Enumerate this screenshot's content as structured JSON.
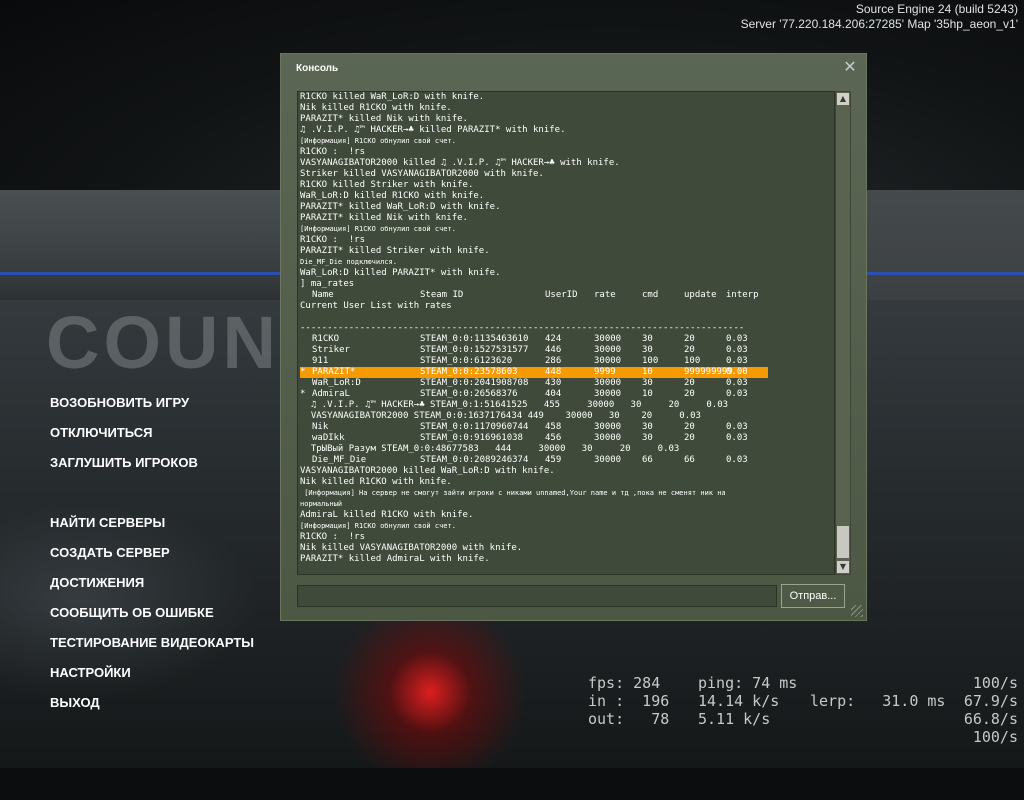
{
  "engine": {
    "version": "Source Engine 24 (build 5243)",
    "server": "Server '77.220.184.206:27285' Map '35hp_aeon_v1'"
  },
  "background_logo": "COUNTER-STRIKE",
  "menu": [
    "ВОЗОБНОВИТЬ ИГРУ",
    "ОТКЛЮЧИТЬСЯ",
    "ЗАГЛУШИТЬ ИГРОКОВ",
    "НАЙТИ СЕРВЕРЫ",
    "СОЗДАТЬ СЕРВЕР",
    "ДОСТИЖЕНИЯ",
    "СООБЩИТЬ ОБ ОШИБКЕ",
    "ТЕСТИРОВАНИЕ ВИДЕОКАРТЫ",
    "НАСТРОЙКИ",
    "ВЫХОД"
  ],
  "console": {
    "title": "Консоль",
    "close_glyph": "✕",
    "send_label": "Отправ...",
    "input_value": "",
    "log_before": [
      {
        "t": "R1CKO killed WaR_LoR:D with knife."
      },
      {
        "t": "Nik killed R1CKO with knife."
      },
      {
        "t": "PARAZIT* killed Nik with knife."
      },
      {
        "t": "♫ .V.I.P. ♫™ HACKER→♣ killed PARAZIT* with knife."
      },
      {
        "t": "[Информация] R1CKO обнулил свой счет.",
        "small": true
      },
      {
        "t": "R1CKO :  !rs"
      },
      {
        "t": "VASYANAGIBATOR2000 killed ♫ .V.I.P. ♫™ HACKER→♣ with knife."
      },
      {
        "t": "Striker killed VASYANAGIBATOR2000 with knife."
      },
      {
        "t": "R1CKO killed Striker with knife."
      },
      {
        "t": "WaR_LoR:D killed R1CKO with knife."
      },
      {
        "t": "PARAZIT* killed WaR_LoR:D with knife."
      },
      {
        "t": "PARAZIT* killed Nik with knife."
      },
      {
        "t": "[Информация] R1CKO обнулил свой счет.",
        "small": true
      },
      {
        "t": "R1CKO :  !rs"
      },
      {
        "t": "PARAZIT* killed Striker with knife."
      },
      {
        "t": "Die_MF_Die подключился.",
        "small": true
      },
      {
        "t": "WaR_LoR:D killed PARAZIT* with knife."
      },
      {
        "t": "] ma_rates"
      }
    ],
    "rates_header": {
      "name": "Name",
      "steam": "Steam ID",
      "uid": "UserID",
      "rate": "rate",
      "cmd": "cmd",
      "update": "update",
      "interp": "interp"
    },
    "rates_title": "Current User List with rates",
    "rates_separator": "----------------------------------------------------------------------------------",
    "rates_rows": [
      {
        "mark": "",
        "name": "R1CKO",
        "steam": "STEAM_0:0:1135463610",
        "uid": "424",
        "rate": "30000",
        "cmd": "30",
        "update": "20",
        "interp": "0.03"
      },
      {
        "mark": "",
        "name": "Striker",
        "steam": "STEAM_0:0:1527531577",
        "uid": "446",
        "rate": "30000",
        "cmd": "30",
        "update": "20",
        "interp": "0.03"
      },
      {
        "mark": "",
        "name": "911",
        "steam": "STEAM_0:0:6123620",
        "uid": "286",
        "rate": "30000",
        "cmd": "100",
        "update": "100",
        "interp": "0.03"
      },
      {
        "mark": "*",
        "name": "PARAZIT*",
        "steam": "STEAM_0:0:23578603",
        "uid": "448",
        "rate": "9999",
        "cmd": "10",
        "update": "999999999",
        "interp": "0.00",
        "highlight": true
      },
      {
        "mark": "",
        "name": "WaR_LoR:D",
        "steam": "STEAM_0:0:2041908708",
        "uid": "430",
        "rate": "30000",
        "cmd": "30",
        "update": "20",
        "interp": "0.03"
      },
      {
        "mark": "*",
        "name": "AdmiraL",
        "steam": "STEAM_0:0:26568376",
        "uid": "404",
        "rate": "30000",
        "cmd": "10",
        "update": "20",
        "interp": "0.03"
      }
    ],
    "rates_raw": [
      "  ♫ .V.I.P. ♫™ HACKER→♣ STEAM_0:1:51641525   455     30000   30     20     0.03",
      "  VASYANAGIBATOR2000 STEAM_0:0:1637176434 449    30000   30    20     0.03"
    ],
    "rates_rows2": [
      {
        "mark": "",
        "name": "Nik",
        "steam": "STEAM_0:0:1170960744",
        "uid": "458",
        "rate": "30000",
        "cmd": "30",
        "update": "20",
        "interp": "0.03"
      },
      {
        "mark": "",
        "name": "waDIkk",
        "steam": "STEAM_0:0:916961038",
        "uid": "456",
        "rate": "30000",
        "cmd": "30",
        "update": "20",
        "interp": "0.03"
      }
    ],
    "rates_raw2": "  ТрЫВый Разум STEAM_0:0:48677583   444     30000   30     20     0.03",
    "rates_rows3": [
      {
        "mark": "",
        "name": "Die_MF_Die",
        "steam": "STEAM_0:0:2089246374",
        "uid": "459",
        "rate": "30000",
        "cmd": "66",
        "update": "66",
        "interp": "0.03"
      }
    ],
    "log_after": [
      {
        "t": "VASYANAGIBATOR2000 killed WaR_LoR:D with knife."
      },
      {
        "t": "Nik killed R1CKO with knife."
      },
      {
        "t": " [Информация] На сервер не смогут зайти игроки с никами unnamed,Your name и тд ,пока не сменят ник на",
        "small": true
      },
      {
        "t": "нормальный",
        "small": true
      },
      {
        "t": "AdmiraL killed R1CKO with knife."
      },
      {
        "t": "[Информация] R1CKO обнулил свой счет.",
        "small": true
      },
      {
        "t": "R1CKO :  !rs"
      },
      {
        "t": "Nik killed VASYANAGIBATOR2000 with knife."
      },
      {
        "t": "PARAZIT* killed AdmiraL with knife."
      }
    ]
  },
  "netgraph": {
    "fps": "fps: 284",
    "ping": "ping: 74 ms",
    "rate1": "100/s",
    "in": "in :  196",
    "in_speed": "14.14 k/s",
    "lerp": "lerp:   31.0 ms",
    "rate2": "67.9/s",
    "out": "out:   78",
    "out_speed": "5.11 k/s",
    "rate3": "66.8/s",
    "rate4": "100/s"
  },
  "colors": {
    "highlight": "#f79a00",
    "console_bg": "#4c5844",
    "text": "#ffffff"
  }
}
